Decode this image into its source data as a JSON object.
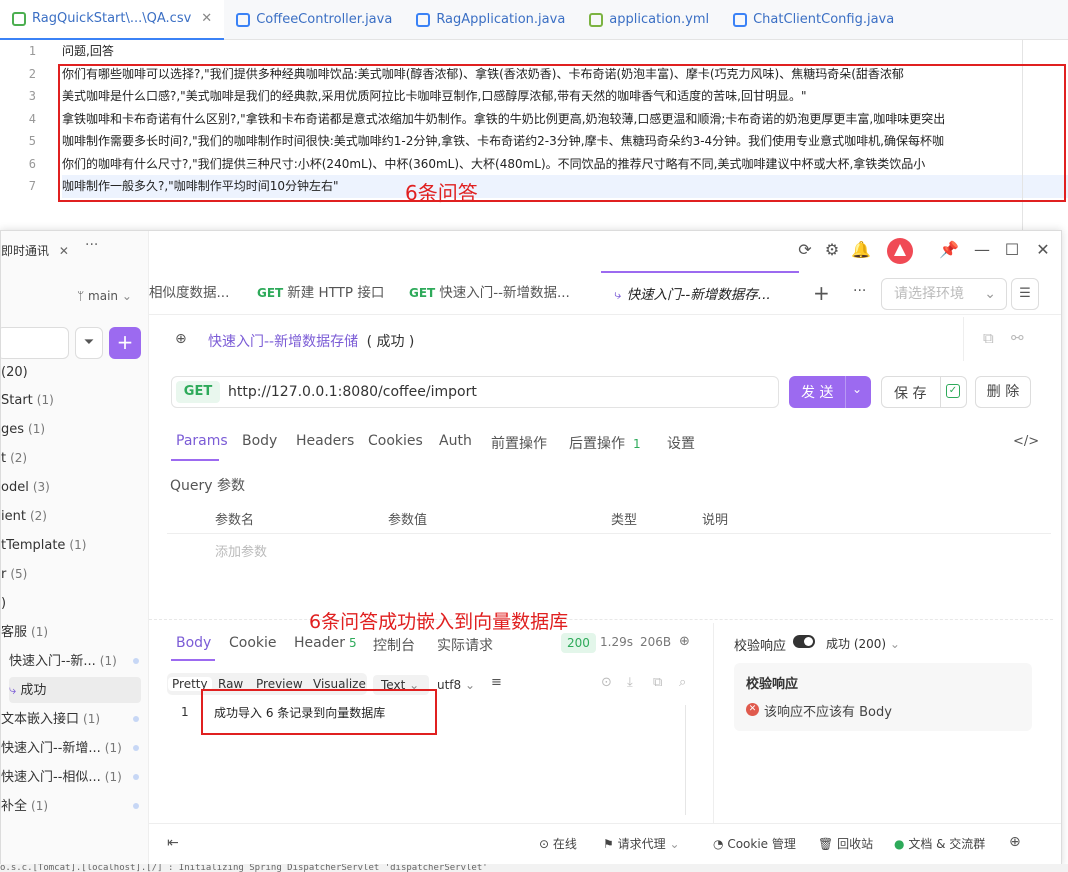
{
  "ide": {
    "tabs": [
      {
        "label": "RagQuickStart\\...\\QA.csv",
        "color": "#4caf50"
      },
      {
        "label": "CoffeeController.java",
        "color": "#3b82f6"
      },
      {
        "label": "RagApplication.java",
        "color": "#3b82f6"
      },
      {
        "label": "application.yml",
        "color": "#7cb342"
      },
      {
        "label": "ChatClientConfig.java",
        "color": "#3b82f6"
      }
    ],
    "line_numbers": [
      "1",
      "2",
      "3",
      "4",
      "5",
      "6",
      "7"
    ],
    "lines": [
      "问题,回答",
      "你们有哪些咖啡可以选择?,\"我们提供多种经典咖啡饮品:美式咖啡(醇香浓郁)、拿铁(香浓奶香)、卡布奇诺(奶泡丰富)、摩卡(巧克力风味)、焦糖玛奇朵(甜香浓郁",
      "美式咖啡是什么口感?,\"美式咖啡是我们的经典款,采用优质阿拉比卡咖啡豆制作,口感醇厚浓郁,带有天然的咖啡香气和适度的苦味,回甘明显。\"",
      "拿铁咖啡和卡布奇诺有什么区别?,\"拿铁和卡布奇诺都是意式浓缩加牛奶制作。拿铁的牛奶比例更高,奶泡较薄,口感更温和顺滑;卡布奇诺的奶泡更厚更丰富,咖啡味更突出",
      "咖啡制作需要多长时间?,\"我们的咖啡制作时间很快:美式咖啡约1-2分钟,拿铁、卡布奇诺约2-3分钟,摩卡、焦糖玛奇朵约3-4分钟。我们使用专业意式咖啡机,确保每杯咖",
      "你们的咖啡有什么尺寸?,\"我们提供三种尺寸:小杯(240mL)、中杯(360mL)、大杯(480mL)。不同饮品的推荐尺寸略有不同,美式咖啡建议中杯或大杯,拿铁类饮品小",
      "咖啡制作一般多久?,\"咖啡制作平均时间10分钟左右\""
    ],
    "annotation": "6条问答"
  },
  "apifox": {
    "window_tab_label": "即时通讯",
    "branch": "main",
    "sidebar": [
      {
        "label": "(20)",
        "count": ""
      },
      {
        "label": "Start",
        "count": "(1)"
      },
      {
        "label": "ges",
        "count": "(1)"
      },
      {
        "label": "t",
        "count": "(2)"
      },
      {
        "label": "odel",
        "count": "(3)"
      },
      {
        "label": "ient",
        "count": "(2)"
      },
      {
        "label": "tTemplate",
        "count": "(1)"
      },
      {
        "label": "r",
        "count": "(5)"
      },
      {
        "label": ")",
        "count": ""
      },
      {
        "label": "客服",
        "count": "(1)"
      },
      {
        "label": "快速入门--新...",
        "count": "(1)"
      },
      {
        "label": "成功",
        "count": ""
      },
      {
        "label": "文本嵌入接口",
        "count": "(1)"
      },
      {
        "label": "快速入门--新增...",
        "count": "(1)"
      },
      {
        "label": "快速入门--相似...",
        "count": "(1)"
      },
      {
        "label": "补全",
        "count": "(1)"
      }
    ],
    "tabs": [
      {
        "method": "",
        "label": "相似度数据..."
      },
      {
        "method": "GET",
        "label": "新建 HTTP 接口"
      },
      {
        "method": "GET",
        "label": "快速入门--新增数据..."
      },
      {
        "method": "",
        "label": "快速入门--新增数据存..."
      }
    ],
    "env_placeholder": "请选择环境",
    "case_title": "快速入门--新增数据存储",
    "case_status": "( 成功 )",
    "method": "GET",
    "url": "http://127.0.0.1:8080/coffee/import",
    "send_label": "发 送",
    "save_label": "保 存",
    "delete_label": "删 除",
    "req_tabs": [
      "Params",
      "Body",
      "Headers",
      "Cookies",
      "Auth",
      "前置操作",
      "后置操作",
      "设置"
    ],
    "post_ops_count": "1",
    "query_title": "Query 参数",
    "param_cols": [
      "参数名",
      "参数值",
      "类型",
      "说明"
    ],
    "add_param": "添加参数",
    "resp_tabs": [
      "Body",
      "Cookie",
      "Header",
      "控制台",
      "实际请求"
    ],
    "header_count": "5",
    "status_code": "200",
    "time": "1.29s",
    "size": "206B",
    "view_modes": [
      "Pretty",
      "Raw",
      "Preview",
      "Visualize"
    ],
    "format": "Text",
    "encoding": "utf8",
    "resp_line_no": "1",
    "resp_body": "成功导入 6 条记录到向量数据库",
    "resp_annotation": "6条问答成功嵌入到向量数据库",
    "validate_label": "校验响应",
    "validate_status": "成功 (200)",
    "validate_title": "校验响应",
    "validate_error": "该响应不应该有 Body",
    "footer": {
      "online": "在线",
      "proxy": "请求代理",
      "cookie": "Cookie 管理",
      "trash": "回收站",
      "docs": "文档 & 交流群"
    }
  },
  "console_strip": "o.s.c.[Tomcat].[localhost].[/]       : Initializing Spring DispatcherServlet 'dispatcherServlet'"
}
